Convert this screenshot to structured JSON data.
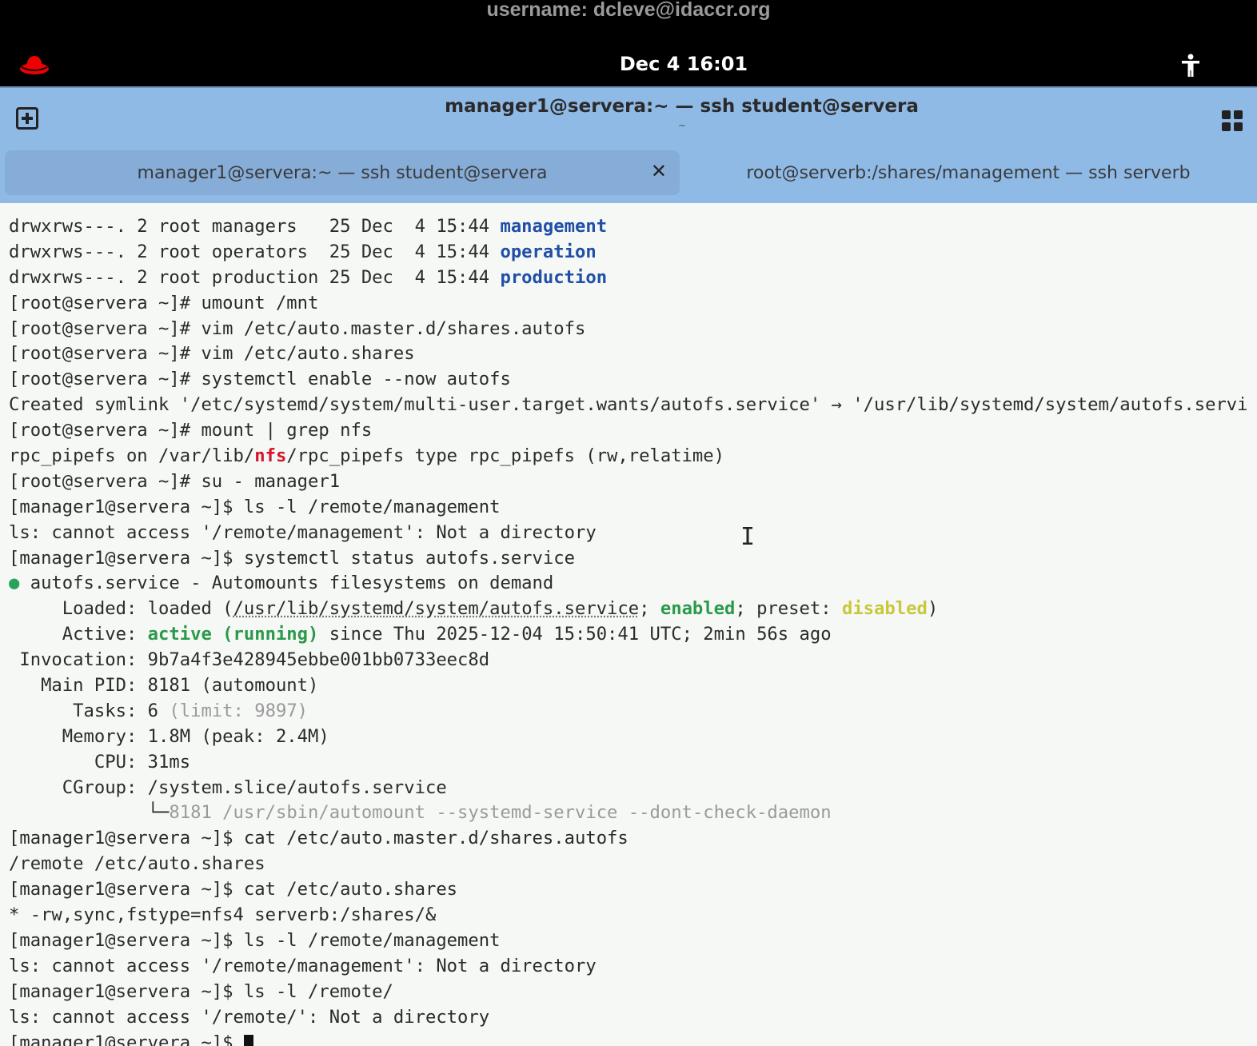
{
  "topbar": {
    "username": "username: dcleve@idaccr.org",
    "clock": "Dec 4  16:01"
  },
  "window": {
    "title": "manager1@servera:~ — ssh student@servera",
    "subtitle": "~"
  },
  "tabs": [
    {
      "label": "manager1@servera:~ — ssh student@servera",
      "active": true,
      "close": "✕"
    },
    {
      "label": "root@serverb:/shares/management — ssh serverb",
      "active": false
    }
  ],
  "colors": {
    "header": "#8fbae6",
    "dir": "#1f4fa6",
    "green": "#2a9a4a",
    "yellow": "#c8c83a",
    "red": "#d4162a"
  },
  "terminal": {
    "lines": [
      [
        [
          "drwxrws---. 2 root managers   25 Dec  4 15:44 ",
          ""
        ],
        [
          "management",
          "dir"
        ]
      ],
      [
        [
          "drwxrws---. 2 root operators  25 Dec  4 15:44 ",
          ""
        ],
        [
          "operation",
          "dir"
        ]
      ],
      [
        [
          "drwxrws---. 2 root production 25 Dec  4 15:44 ",
          ""
        ],
        [
          "production",
          "dir"
        ]
      ],
      [
        [
          "[root@servera ~]# umount /mnt",
          ""
        ]
      ],
      [
        [
          "[root@servera ~]# vim /etc/auto.master.d/shares.autofs",
          ""
        ]
      ],
      [
        [
          "[root@servera ~]# vim /etc/auto.shares",
          ""
        ]
      ],
      [
        [
          "[root@servera ~]# systemctl enable --now autofs",
          ""
        ]
      ],
      [
        [
          "Created symlink '/etc/systemd/system/multi-user.target.wants/autofs.service' → '/usr/lib/systemd/system/autofs.servi",
          ""
        ]
      ],
      [
        [
          "[root@servera ~]# mount | grep nfs",
          ""
        ]
      ],
      [
        [
          "rpc_pipefs on /var/lib/",
          ""
        ],
        [
          "nfs",
          "red"
        ],
        [
          "/rpc_pipefs type rpc_pipefs (rw,relatime)",
          ""
        ]
      ],
      [
        [
          "[root@servera ~]# su - manager1",
          ""
        ]
      ],
      [
        [
          "[manager1@servera ~]$ ls -l /remote/management",
          ""
        ]
      ],
      [
        [
          "ls: cannot access '/remote/management': Not a directory",
          ""
        ]
      ],
      [
        [
          "[manager1@servera ~]$ systemctl status autofs.service",
          ""
        ]
      ],
      [
        [
          "●",
          "dot"
        ],
        [
          " autofs.service - Automounts filesystems on demand",
          ""
        ]
      ],
      [
        [
          "     Loaded: loaded (",
          ""
        ],
        [
          "/usr/lib/systemd/system/autofs.service",
          "ul"
        ],
        [
          "; ",
          ""
        ],
        [
          "enabled",
          "grn"
        ],
        [
          "; preset: ",
          ""
        ],
        [
          "disabled",
          "yel"
        ],
        [
          ")",
          ""
        ]
      ],
      [
        [
          "     Active: ",
          ""
        ],
        [
          "active (running)",
          "grn"
        ],
        [
          " since Thu 2025-12-04 15:50:41 UTC; 2min 56s ago",
          ""
        ]
      ],
      [
        [
          " Invocation: 9b7a4f3e428945ebbe001bb0733eec8d",
          ""
        ]
      ],
      [
        [
          "   Main PID: 8181 (automount)",
          ""
        ]
      ],
      [
        [
          "      Tasks: 6 ",
          ""
        ],
        [
          "(limit: 9897)",
          "dim"
        ]
      ],
      [
        [
          "     Memory: 1.8M (peak: 2.4M)",
          ""
        ]
      ],
      [
        [
          "        CPU: 31ms",
          ""
        ]
      ],
      [
        [
          "     CGroup: /system.slice/autofs.service",
          ""
        ]
      ],
      [
        [
          "             └─",
          ""
        ],
        [
          "8181 /usr/sbin/automount --systemd-service --dont-check-daemon",
          "dim"
        ]
      ],
      [
        [
          "[manager1@servera ~]$ cat /etc/auto.master.d/shares.autofs",
          ""
        ]
      ],
      [
        [
          "/remote /etc/auto.shares",
          ""
        ]
      ],
      [
        [
          "[manager1@servera ~]$ cat /etc/auto.shares",
          ""
        ]
      ],
      [
        [
          "* -rw,sync,fstype=nfs4 serverb:/shares/&",
          ""
        ]
      ],
      [
        [
          "[manager1@servera ~]$ ls -l /remote/management",
          ""
        ]
      ],
      [
        [
          "ls: cannot access '/remote/management': Not a directory",
          ""
        ]
      ],
      [
        [
          "[manager1@servera ~]$ ls -l /remote/",
          ""
        ]
      ],
      [
        [
          "ls: cannot access '/remote/': Not a directory",
          ""
        ]
      ],
      [
        [
          "[manager1@servera ~]$ ",
          ""
        ]
      ]
    ]
  }
}
